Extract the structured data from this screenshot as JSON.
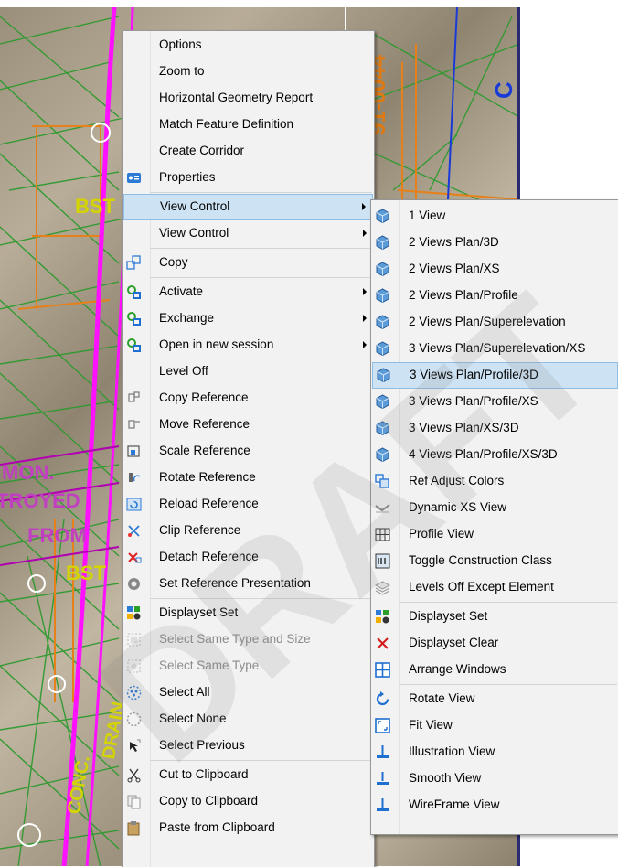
{
  "main_menu": {
    "items": [
      {
        "label": "Options",
        "icon": ""
      },
      {
        "label": "Zoom to",
        "icon": ""
      },
      {
        "label": "Horizontal Geometry Report",
        "icon": ""
      },
      {
        "label": "Match Feature Definition",
        "icon": ""
      },
      {
        "label": "Create Corridor",
        "icon": ""
      },
      {
        "label": "Properties",
        "icon": "properties-icon"
      },
      {
        "label": "View Control",
        "icon": "",
        "submenu": true,
        "highlighted": true
      },
      {
        "label": "View Control",
        "icon": "",
        "submenu": true
      },
      {
        "label": "Copy",
        "icon": "copy-icon"
      },
      {
        "label": "Activate",
        "icon": "reference-activate-icon",
        "submenu": true
      },
      {
        "label": "Exchange",
        "icon": "reference-exchange-icon",
        "submenu": true
      },
      {
        "label": "Open in new session",
        "icon": "reference-open-icon",
        "submenu": true
      },
      {
        "label": "Level Off",
        "icon": ""
      },
      {
        "label": "Copy Reference",
        "icon": "copy-reference-icon"
      },
      {
        "label": "Move Reference",
        "icon": "move-reference-icon"
      },
      {
        "label": "Scale Reference",
        "icon": "scale-reference-icon"
      },
      {
        "label": "Rotate Reference",
        "icon": "rotate-reference-icon"
      },
      {
        "label": "Reload Reference",
        "icon": "reload-reference-icon"
      },
      {
        "label": "Clip Reference",
        "icon": "clip-reference-icon"
      },
      {
        "label": "Detach Reference",
        "icon": "detach-reference-icon"
      },
      {
        "label": "Set Reference Presentation",
        "icon": "presentation-icon"
      },
      {
        "label": "Displayset Set",
        "icon": "displayset-icon"
      },
      {
        "label": "Select Same Type and Size",
        "icon": "select-type-size-icon",
        "disabled": true
      },
      {
        "label": "Select Same Type",
        "icon": "select-type-icon",
        "disabled": true
      },
      {
        "label": "Select All",
        "icon": "select-all-icon"
      },
      {
        "label": "Select None",
        "icon": "select-none-icon"
      },
      {
        "label": "Select Previous",
        "icon": "select-previous-icon"
      },
      {
        "label": "Cut to Clipboard",
        "icon": "scissors-icon"
      },
      {
        "label": "Copy to Clipboard",
        "icon": "clipboard-copy-icon"
      },
      {
        "label": "Paste from Clipboard",
        "icon": "clipboard-paste-icon"
      }
    ]
  },
  "sub_menu": {
    "items": [
      {
        "label": "1 View",
        "icon": "view-cube-icon"
      },
      {
        "label": "2 Views Plan/3D",
        "icon": "view-cube-icon"
      },
      {
        "label": "2 Views Plan/XS",
        "icon": "view-cube-icon"
      },
      {
        "label": "2 Views Plan/Profile",
        "icon": "view-cube-icon"
      },
      {
        "label": "2 Views Plan/Superelevation",
        "icon": "view-cube-icon"
      },
      {
        "label": "3 Views Plan/Superelevation/XS",
        "icon": "view-cube-icon"
      },
      {
        "label": "3 Views Plan/Profile/3D",
        "icon": "view-cube-icon",
        "highlighted": true
      },
      {
        "label": "3 Views Plan/Profile/XS",
        "icon": "view-cube-icon"
      },
      {
        "label": "3 Views Plan/XS/3D",
        "icon": "view-cube-icon"
      },
      {
        "label": "4 Views Plan/Profile/XS/3D",
        "icon": "view-cube-icon"
      },
      {
        "label": "Ref Adjust Colors",
        "icon": "ref-adjust-colors-icon"
      },
      {
        "label": "Dynamic XS View",
        "icon": "dynamic-xs-icon"
      },
      {
        "label": "Profile View",
        "icon": "profile-view-icon"
      },
      {
        "label": "Toggle Construction Class",
        "icon": "construction-class-icon"
      },
      {
        "label": "Levels Off Except Element",
        "icon": "levels-icon"
      },
      {
        "label": "Displayset Set",
        "icon": "displayset-icon"
      },
      {
        "label": "Displayset Clear",
        "icon": "close-icon"
      },
      {
        "label": "Arrange Windows",
        "icon": "arrange-windows-icon"
      },
      {
        "label": "Rotate View",
        "icon": "rotate-view-icon"
      },
      {
        "label": "Fit View",
        "icon": "fit-view-icon"
      },
      {
        "label": "Illustration View",
        "icon": "render-view-icon"
      },
      {
        "label": "Smooth View",
        "icon": "render-view-icon"
      },
      {
        "label": "WireFrame View",
        "icon": "render-view-icon"
      }
    ]
  },
  "map_labels": {
    "bst_1": "BST",
    "bst_2": "BST",
    "station": "91-0044",
    "letters_c": "C",
    "mon": "MON.",
    "troyed": "TROYED",
    "from": "FROM",
    "conc": "CONC.",
    "drain": "DRAIN"
  },
  "watermark": "DRAFT",
  "colors": {
    "menu_bg": "#f2f2f2",
    "highlight": "#cde3f3",
    "highlight_border": "#8fbde4",
    "disabled_text": "#8c8c8c",
    "road_magenta": "#ff00ff",
    "line_green": "#2fa02f",
    "line_orange": "#e07a10"
  }
}
